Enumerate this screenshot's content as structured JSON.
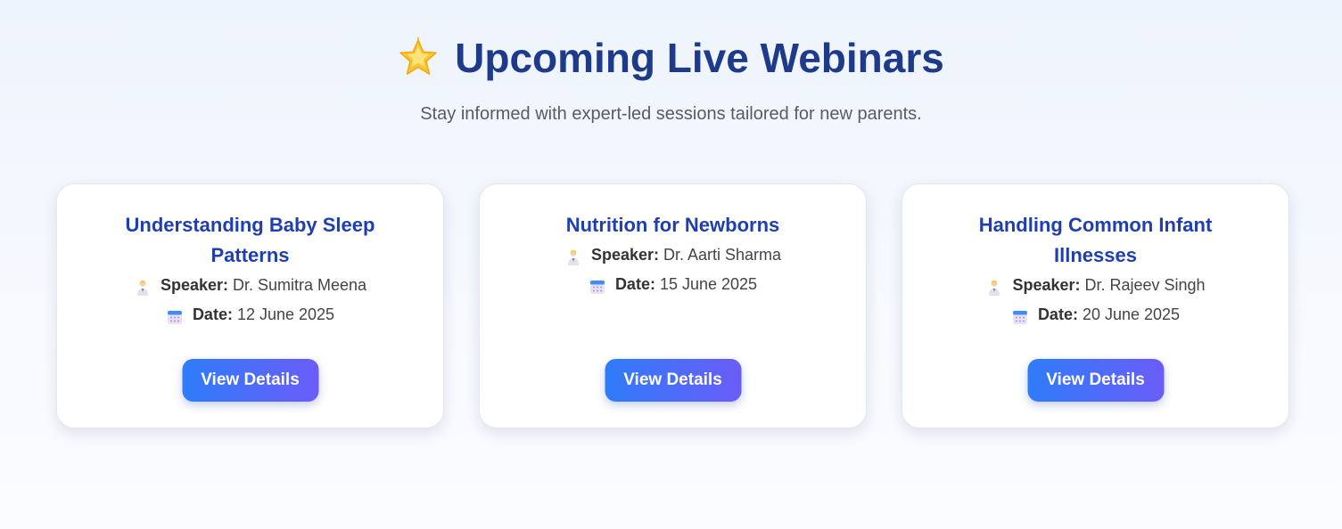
{
  "header": {
    "icon": "glowing-star-icon",
    "title": "Upcoming Live Webinars",
    "subtitle": "Stay informed with expert-led sessions tailored for new parents."
  },
  "labels": {
    "speaker": "Speaker:",
    "date": "Date:",
    "button": "View Details"
  },
  "icons": {
    "speaker": "doctor-icon",
    "date": "calendar-icon"
  },
  "colors": {
    "title": "#1e3a8a",
    "card_title": "#1f3fb0",
    "button_start": "#2f7cfb",
    "button_end": "#6a5cf8"
  },
  "webinars": [
    {
      "title": "Understanding Baby Sleep Patterns",
      "speaker": "Dr. Sumitra Meena",
      "date": "12 June 2025"
    },
    {
      "title": "Nutrition for Newborns",
      "speaker": "Dr. Aarti Sharma",
      "date": "15 June 2025"
    },
    {
      "title": "Handling Common Infant Illnesses",
      "speaker": "Dr. Rajeev Singh",
      "date": "20 June 2025"
    }
  ]
}
